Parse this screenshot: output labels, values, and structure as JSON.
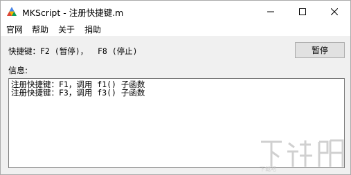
{
  "window": {
    "title": "MKScript - 注册快捷键.m"
  },
  "icons": {
    "app": "app-logo-icon",
    "minimize": "minimize-icon",
    "maximize": "maximize-icon",
    "close": "close-icon"
  },
  "menu": {
    "items": [
      {
        "label": "官网"
      },
      {
        "label": "帮助"
      },
      {
        "label": "关于"
      },
      {
        "label": "捐助"
      }
    ]
  },
  "hotkeys": {
    "text": "快捷键：F2 (暂停)，  F8 (停止)"
  },
  "pause_button": {
    "label": "暂停"
  },
  "info": {
    "label": "信息:",
    "lines": [
      "注册快捷键：F1，调用 f1() 子函数",
      "注册快捷键：F3，调用 f3() 子函数"
    ]
  },
  "watermark": {
    "text": "下载吧"
  },
  "colors": {
    "window_bg": "#f0f0f0",
    "titlebar_bg": "#ffffff",
    "button_bg": "#e1e1e1",
    "button_border": "#adadad",
    "textbox_border": "#7a7a7a"
  }
}
